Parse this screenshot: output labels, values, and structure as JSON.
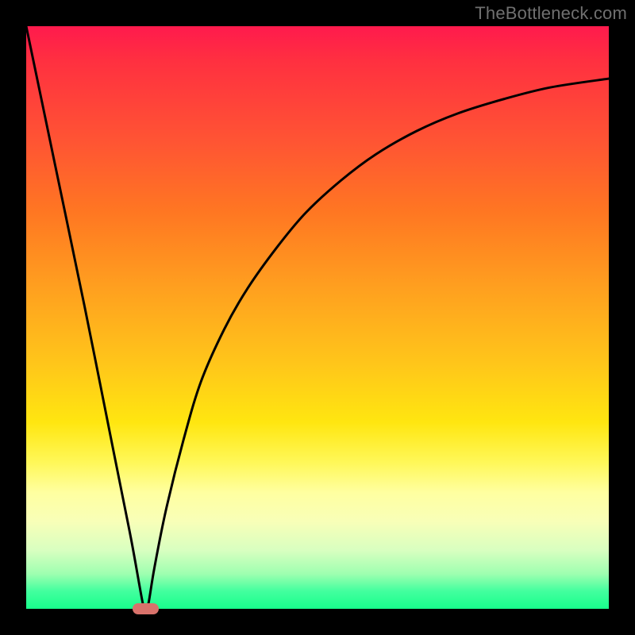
{
  "watermark": "TheBottleneck.com",
  "chart_data": {
    "type": "line",
    "title": "",
    "xlabel": "",
    "ylabel": "",
    "xlim": [
      0,
      100
    ],
    "ylim": [
      0,
      100
    ],
    "series": [
      {
        "name": "curve",
        "x": [
          0,
          5,
          10,
          15,
          18,
          20,
          20.5,
          21,
          22,
          24,
          27,
          30,
          34,
          38,
          43,
          48,
          54,
          60,
          67,
          74,
          82,
          90,
          100
        ],
        "values": [
          100,
          76,
          52,
          27,
          12,
          1,
          0,
          1,
          7,
          17,
          29,
          39,
          48,
          55,
          62,
          68,
          73.5,
          78,
          82,
          85,
          87.5,
          89.5,
          91
        ]
      }
    ],
    "marker": {
      "x_center": 20.5,
      "y": 0,
      "width_pct": 4.5
    },
    "gradient_stops": [
      {
        "pos": 0,
        "color": "#ff1a4d"
      },
      {
        "pos": 50,
        "color": "#ffb81f"
      },
      {
        "pos": 75,
        "color": "#fff85a"
      },
      {
        "pos": 100,
        "color": "#18ff8c"
      }
    ]
  }
}
